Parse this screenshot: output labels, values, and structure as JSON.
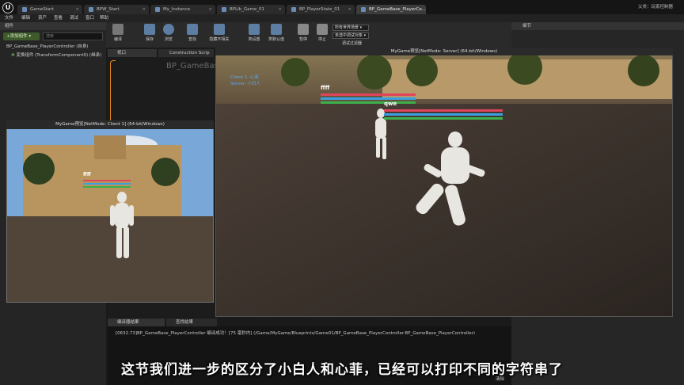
{
  "tabs": [
    {
      "label": "GameStart"
    },
    {
      "label": "BPW_Start"
    },
    {
      "label": "My_Instance"
    },
    {
      "label": "BPLib_Game_01"
    },
    {
      "label": "BP_PlayerState_01"
    },
    {
      "label": "BP_GameBase_PlayerCo..."
    }
  ],
  "top_right": "父类：玩家控制器",
  "menu": [
    "文件",
    "编辑",
    "资产",
    "查看",
    "调试",
    "窗口",
    "帮助"
  ],
  "components": {
    "header": "组件",
    "add_label": "+添加组件 ▾",
    "search_placeholder": "搜索",
    "root": "BP_GameBase_PlayerController (自身)",
    "child": "变换组件 (TransformComponent0) (继承)"
  },
  "toolbar": {
    "compile": "编译",
    "save": "保存",
    "browse": "浏览",
    "find": "查找",
    "hide": "隐藏不相关",
    "class_settings": "类设置",
    "class_defaults": "类默认值",
    "pause": "暂停",
    "stop": "停止",
    "debug_world": "所有世界场景 ▾",
    "debug_object": "未选中调试对象 ▾",
    "debug_filter": "调试过滤器"
  },
  "details": {
    "header": "细节"
  },
  "graph": {
    "viewport_tab": "视口",
    "cs_tab": "Construction Scrip",
    "bp_name": "BP_GameBase_"
  },
  "server_window": {
    "title": "MyGame预览[NetMode: Server] (64-bit/Windows)",
    "hud_line1": "Client 1: 心菲",
    "hud_line2": "Server: 小白人",
    "name1": "ffff",
    "name2": "qwe"
  },
  "client_window": {
    "title": "MyGame预览[NetMode: Client 1] (64-bit/Windows)",
    "name": "ffff"
  },
  "output": {
    "tab1": "编译器结果",
    "tab2": "查找结果",
    "log": "[0632.73]BP_GameBase_PlayerController 编译成功！[75 毫秒内] (/Game/MyGame/Blueprints/Game01/BP_GameBase_PlayerController.BP_GameBase_PlayerController)",
    "clear": "清除"
  },
  "subtitle": "这节我们进一步的区分了小白人和心菲，已经可以打印不同的字符串了",
  "colors": {
    "health": "#e0455a",
    "mana": "#3aa0e0",
    "stamina": "#3cb04a",
    "accent": "#e38a1f"
  }
}
